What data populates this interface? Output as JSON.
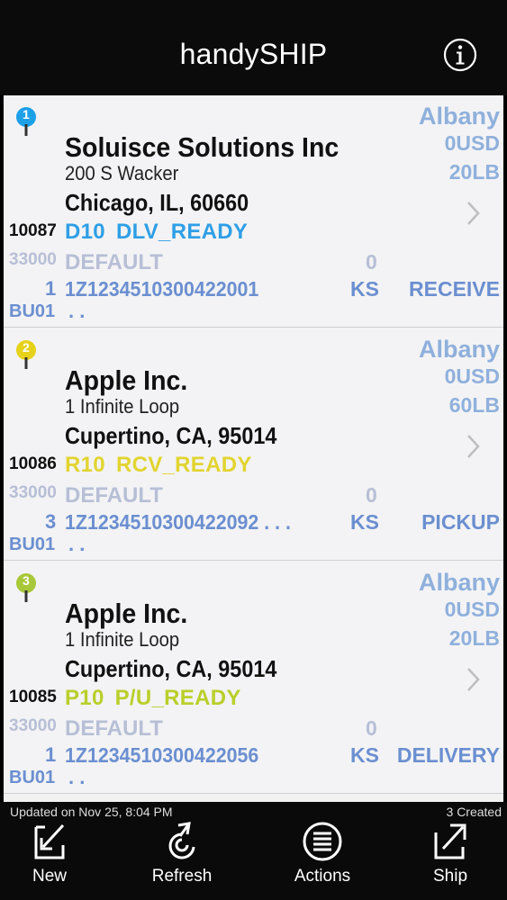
{
  "header": {
    "title": "handySHIP"
  },
  "items": [
    {
      "pin_color": "#1ea0e8",
      "pin_number": "1",
      "company": "Soluisce Solutions Inc",
      "street": "200 S Wacker",
      "city_line": "Chicago, IL, 60660",
      "number": "10087",
      "status_code": "D10",
      "status_text": "DLV_READY",
      "status_color": "#2f9fe6",
      "plant": "33000",
      "default_label": "DEFAULT",
      "zero": "0",
      "count": "1",
      "tracking": "1Z1234510300422001",
      "unit": "KS",
      "action": "RECEIVE",
      "bu": "BU01",
      "dots": ". .",
      "location": "Albany",
      "currency": "0USD",
      "weight": "20LB"
    },
    {
      "pin_color": "#e6d21a",
      "pin_number": "2",
      "company": "Apple Inc.",
      "street": "1 Infinite Loop",
      "city_line": "Cupertino, CA, 95014",
      "number": "10086",
      "status_code": "R10",
      "status_text": "RCV_READY",
      "status_color": "#e2d430",
      "plant": "33000",
      "default_label": "DEFAULT",
      "zero": "0",
      "count": "3",
      "tracking": "1Z1234510300422092 . . .",
      "unit": "KS",
      "action": "PICKUP",
      "bu": "BU01",
      "dots": ". .",
      "location": "Albany",
      "currency": "0USD",
      "weight": "60LB"
    },
    {
      "pin_color": "#a8c83a",
      "pin_number": "3",
      "company": "Apple Inc.",
      "street": "1 Infinite Loop",
      "city_line": "Cupertino, CA, 95014",
      "number": "10085",
      "status_code": "P10",
      "status_text": "P/U_READY",
      "status_color": "#b9cf2a",
      "plant": "33000",
      "default_label": "DEFAULT",
      "zero": "0",
      "count": "1",
      "tracking": "1Z1234510300422056",
      "unit": "KS",
      "action": "DELIVERY",
      "bu": "BU01",
      "dots": ". .",
      "location": "Albany",
      "currency": "0USD",
      "weight": "20LB"
    }
  ],
  "footer": {
    "updated": "Updated on Nov 25, 8:04 PM",
    "created": "3 Created",
    "new_label": "New",
    "refresh_label": "Refresh",
    "actions_label": "Actions",
    "ship_label": "Ship"
  },
  "icons": {
    "info": "info-icon",
    "pin": "map-pin-icon",
    "chevron": "chevron-right-icon",
    "new": "new-icon",
    "refresh": "refresh-icon",
    "actions": "list-icon",
    "ship": "share-icon"
  }
}
